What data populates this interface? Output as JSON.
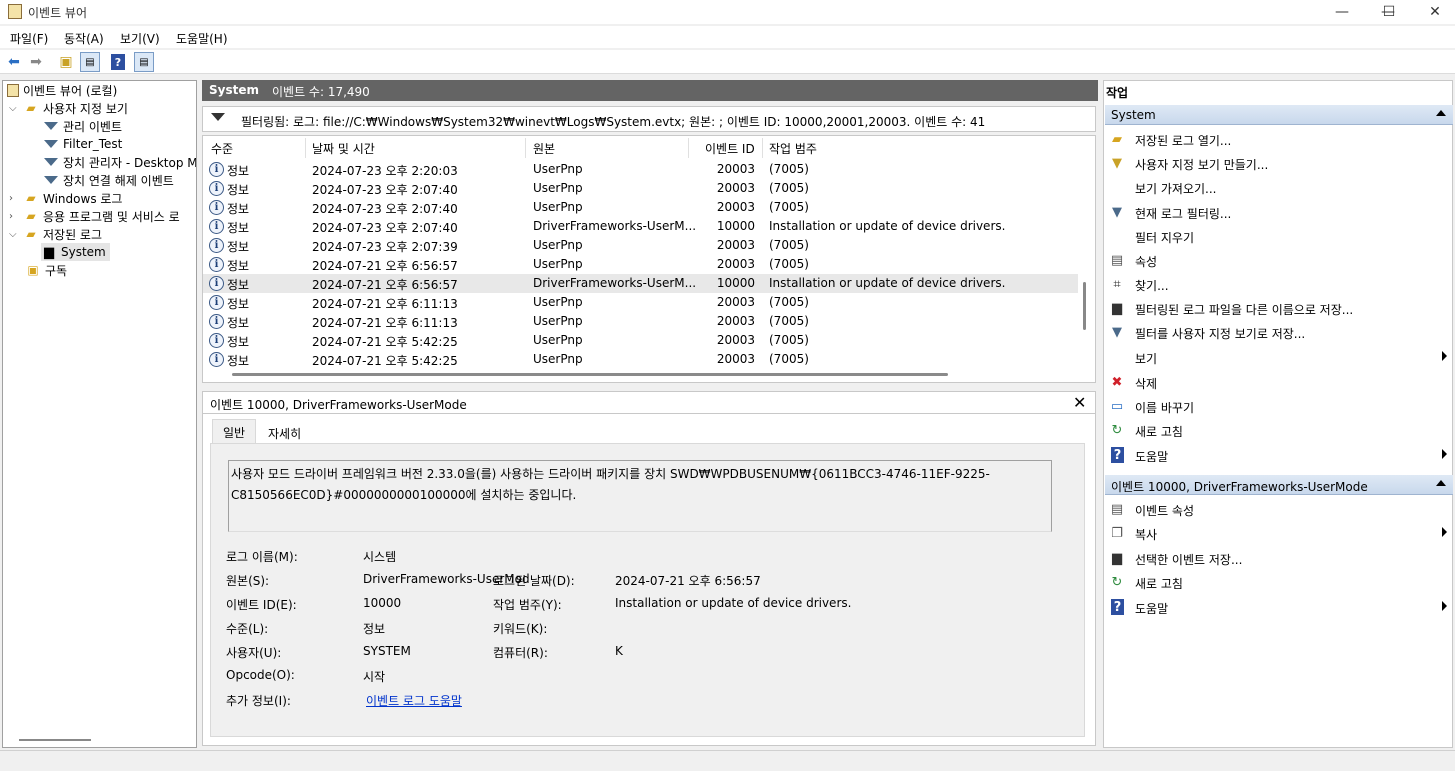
{
  "window": {
    "title": "이벤트 뷰어",
    "minimize": "—",
    "maximize": "☐",
    "close": "✕"
  },
  "menu": [
    "파일(F)",
    "동작(A)",
    "보기(V)",
    "도움말(H)"
  ],
  "tree": {
    "root": "이벤트 뷰어 (로컬)",
    "custom_views": "사용자 지정 보기",
    "admin_events": "관리 이벤트",
    "filter_test": "Filter_Test",
    "device_manager": "장치 관리자 - Desktop M",
    "device_disconnect": "장치 연결 해제 이벤트",
    "windows_logs": "Windows 로그",
    "app_logs": "응용 프로그램 및 서비스 로",
    "saved_logs": "저장된 로그",
    "system": "System",
    "subscriptions": "구독"
  },
  "center": {
    "title": "System",
    "event_count": "이벤트 수: 17,490",
    "filter_text": "필터링됨: 로그: file://C:₩Windows₩System32₩winevt₩Logs₩System.evtx; 원본: ; 이벤트 ID: 10000,20001,20003. 이벤트 수: 41",
    "columns": [
      "수준",
      "날짜 및 시간",
      "원본",
      "이벤트 ID",
      "작업 범주"
    ],
    "rows": [
      [
        "정보",
        "2024-07-23 오후 2:20:03",
        "UserPnp",
        "20003",
        "(7005)"
      ],
      [
        "정보",
        "2024-07-23 오후 2:07:40",
        "UserPnp",
        "20003",
        "(7005)"
      ],
      [
        "정보",
        "2024-07-23 오후 2:07:40",
        "UserPnp",
        "20003",
        "(7005)"
      ],
      [
        "정보",
        "2024-07-23 오후 2:07:40",
        "DriverFrameworks-UserM...",
        "10000",
        "Installation or update of device drivers."
      ],
      [
        "정보",
        "2024-07-23 오후 2:07:39",
        "UserPnp",
        "20003",
        "(7005)"
      ],
      [
        "정보",
        "2024-07-21 오후 6:56:57",
        "UserPnp",
        "20003",
        "(7005)"
      ],
      [
        "정보",
        "2024-07-21 오후 6:56:57",
        "DriverFrameworks-UserM...",
        "10000",
        "Installation or update of device drivers."
      ],
      [
        "정보",
        "2024-07-21 오후 6:11:13",
        "UserPnp",
        "20003",
        "(7005)"
      ],
      [
        "정보",
        "2024-07-21 오후 6:11:13",
        "UserPnp",
        "20003",
        "(7005)"
      ],
      [
        "정보",
        "2024-07-21 오후 5:42:25",
        "UserPnp",
        "20003",
        "(7005)"
      ],
      [
        "정보",
        "2024-07-21 오후 5:42:25",
        "UserPnp",
        "20003",
        "(7005)"
      ]
    ]
  },
  "detail": {
    "title": "이벤트 10000, DriverFrameworks-UserMode",
    "close": "✕",
    "tabs": [
      "일반",
      "자세히"
    ],
    "description_line1": "사용자 모드 드라이버 프레임워크 버전 2.33.0을(를) 사용하는 드라이버 패키지를 장치 SWD₩WPDBUSENUM₩{0611BCC3-4746-11EF-9225-",
    "description_line2": "C8150566EC0D}#0000000000100000에 설치하는 중입니다.",
    "fields": {
      "log_name_label": "로그 이름(M):",
      "log_name": "시스템",
      "source_label": "원본(S):",
      "source": "DriverFrameworks-UserMod",
      "logged_label": "로그된 날짜(D):",
      "logged": "2024-07-21 오후 6:56:57",
      "event_id_label": "이벤트 ID(E):",
      "event_id": "10000",
      "task_label": "작업 범주(Y):",
      "task": "Installation or update of device drivers.",
      "level_label": "수준(L):",
      "level": "정보",
      "keywords_label": "키워드(K):",
      "user_label": "사용자(U):",
      "user": "SYSTEM",
      "computer_label": "컴퓨터(R):",
      "computer": "K",
      "opcode_label": "Opcode(O):",
      "opcode": "시작",
      "more_info_label": "추가 정보(I):",
      "more_info_link": "이벤트 로그 도움말"
    }
  },
  "actions": {
    "title": "작업",
    "section1": "System",
    "items1": [
      "저장된 로그 열기...",
      "사용자 지정 보기 만들기...",
      "보기 가져오기...",
      "현재 로그 필터링...",
      "필터 지우기",
      "속성",
      "찾기...",
      "필터링된 로그 파일을 다른 이름으로 저장...",
      "필터를 사용자 지정 보기로 저장...",
      "보기",
      "삭제",
      "이름 바꾸기",
      "새로 고침",
      "도움말"
    ],
    "section2": "이벤트 10000, DriverFrameworks-UserMode",
    "items2": [
      "이벤트 속성",
      "복사",
      "선택한 이벤트 저장...",
      "새로 고침",
      "도움말"
    ]
  }
}
